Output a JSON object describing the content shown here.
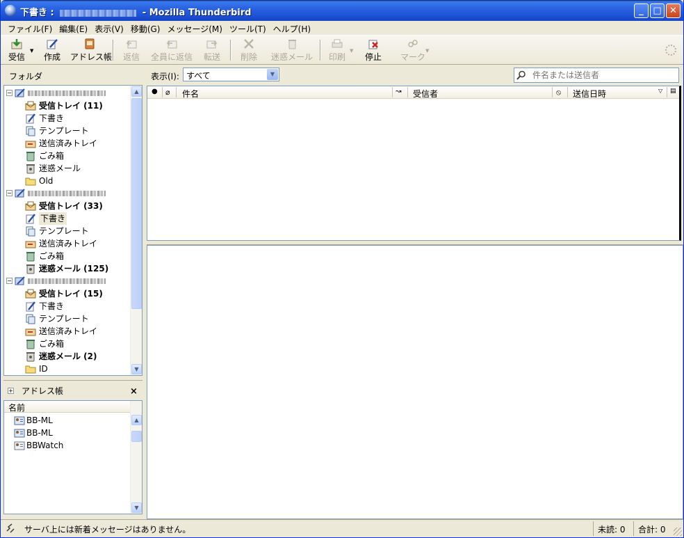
{
  "window": {
    "title_prefix": "下書き : ",
    "title_suffix": " - Mozilla Thunderbird",
    "minimize_glyph": "_",
    "maximize_glyph": "□",
    "close_glyph": "✕"
  },
  "menu": [
    "ファイル(F)",
    "編集(E)",
    "表示(V)",
    "移動(G)",
    "メッセージ(M)",
    "ツール(T)",
    "ヘルプ(H)"
  ],
  "toolbar": {
    "get_mail": "受信",
    "compose": "作成",
    "address_book": "アドレス帳",
    "reply": "返信",
    "reply_all": "全員に返信",
    "forward": "転送",
    "delete": "削除",
    "junk": "迷惑メール",
    "print": "印刷",
    "stop": "停止",
    "mark": "マーク"
  },
  "folder_header": "フォルダ",
  "filter": {
    "label": "表示(I):",
    "selected": "すべて",
    "search_placeholder": "件名または送信者"
  },
  "folders": {
    "account1": [
      {
        "label": "受信トレイ (11)",
        "icon": "inbox-icon",
        "bold": true
      },
      {
        "label": "下書き",
        "icon": "drafts-icon",
        "bold": false
      },
      {
        "label": "テンプレート",
        "icon": "templates-icon",
        "bold": false
      },
      {
        "label": "送信済みトレイ",
        "icon": "sent-icon",
        "bold": false
      },
      {
        "label": "ごみ箱",
        "icon": "trash-icon",
        "bold": false
      },
      {
        "label": "迷惑メール",
        "icon": "junk-icon",
        "bold": false
      },
      {
        "label": "Old",
        "icon": "folder-icon",
        "bold": false
      }
    ],
    "account2": [
      {
        "label": "受信トレイ (33)",
        "icon": "inbox-icon",
        "bold": true
      },
      {
        "label": "下書き",
        "icon": "drafts-icon",
        "bold": false
      },
      {
        "label": "テンプレート",
        "icon": "templates-icon",
        "bold": false
      },
      {
        "label": "送信済みトレイ",
        "icon": "sent-icon",
        "bold": false
      },
      {
        "label": "ごみ箱",
        "icon": "trash-icon",
        "bold": false
      },
      {
        "label": "迷惑メール (125)",
        "icon": "junk-icon",
        "bold": true
      }
    ],
    "account3": [
      {
        "label": "受信トレイ (15)",
        "icon": "inbox-icon",
        "bold": true
      },
      {
        "label": "下書き",
        "icon": "drafts-icon",
        "bold": false
      },
      {
        "label": "テンプレート",
        "icon": "templates-icon",
        "bold": false
      },
      {
        "label": "送信済みトレイ",
        "icon": "sent-icon",
        "bold": false
      },
      {
        "label": "ごみ箱",
        "icon": "trash-icon",
        "bold": false
      },
      {
        "label": "迷惑メール (2)",
        "icon": "junk-icon",
        "bold": true
      },
      {
        "label": "ID",
        "icon": "folder-icon",
        "bold": false
      }
    ]
  },
  "address_book": {
    "title": "アドレス帳",
    "column": "名前",
    "entries": [
      "BB-ML",
      "BB-ML",
      "BBWatch"
    ]
  },
  "thread_columns": {
    "subject": "件名",
    "recipient": "受信者",
    "date": "送信日時"
  },
  "status": {
    "message": "サーバ上には新着メッセージはありません。",
    "unread": "未読: 0",
    "total": "合計: 0"
  },
  "colors": {
    "titlebar": "#2a62e0",
    "chrome": "#ece9d8",
    "border": "#7f9db9"
  }
}
